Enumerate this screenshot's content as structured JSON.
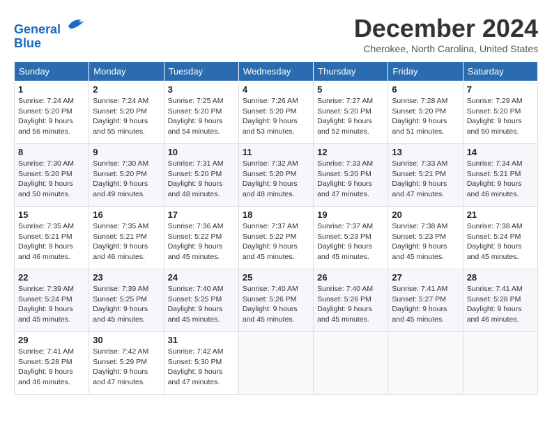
{
  "logo": {
    "line1": "General",
    "line2": "Blue"
  },
  "title": "December 2024",
  "location": "Cherokee, North Carolina, United States",
  "days_header": [
    "Sunday",
    "Monday",
    "Tuesday",
    "Wednesday",
    "Thursday",
    "Friday",
    "Saturday"
  ],
  "weeks": [
    [
      {
        "day": "1",
        "sunrise": "7:24 AM",
        "sunset": "5:20 PM",
        "daylight": "9 hours and 56 minutes."
      },
      {
        "day": "2",
        "sunrise": "7:24 AM",
        "sunset": "5:20 PM",
        "daylight": "9 hours and 55 minutes."
      },
      {
        "day": "3",
        "sunrise": "7:25 AM",
        "sunset": "5:20 PM",
        "daylight": "9 hours and 54 minutes."
      },
      {
        "day": "4",
        "sunrise": "7:26 AM",
        "sunset": "5:20 PM",
        "daylight": "9 hours and 53 minutes."
      },
      {
        "day": "5",
        "sunrise": "7:27 AM",
        "sunset": "5:20 PM",
        "daylight": "9 hours and 52 minutes."
      },
      {
        "day": "6",
        "sunrise": "7:28 AM",
        "sunset": "5:20 PM",
        "daylight": "9 hours and 51 minutes."
      },
      {
        "day": "7",
        "sunrise": "7:29 AM",
        "sunset": "5:20 PM",
        "daylight": "9 hours and 50 minutes."
      }
    ],
    [
      {
        "day": "8",
        "sunrise": "7:30 AM",
        "sunset": "5:20 PM",
        "daylight": "9 hours and 50 minutes."
      },
      {
        "day": "9",
        "sunrise": "7:30 AM",
        "sunset": "5:20 PM",
        "daylight": "9 hours and 49 minutes."
      },
      {
        "day": "10",
        "sunrise": "7:31 AM",
        "sunset": "5:20 PM",
        "daylight": "9 hours and 48 minutes."
      },
      {
        "day": "11",
        "sunrise": "7:32 AM",
        "sunset": "5:20 PM",
        "daylight": "9 hours and 48 minutes."
      },
      {
        "day": "12",
        "sunrise": "7:33 AM",
        "sunset": "5:20 PM",
        "daylight": "9 hours and 47 minutes."
      },
      {
        "day": "13",
        "sunrise": "7:33 AM",
        "sunset": "5:21 PM",
        "daylight": "9 hours and 47 minutes."
      },
      {
        "day": "14",
        "sunrise": "7:34 AM",
        "sunset": "5:21 PM",
        "daylight": "9 hours and 46 minutes."
      }
    ],
    [
      {
        "day": "15",
        "sunrise": "7:35 AM",
        "sunset": "5:21 PM",
        "daylight": "9 hours and 46 minutes."
      },
      {
        "day": "16",
        "sunrise": "7:35 AM",
        "sunset": "5:21 PM",
        "daylight": "9 hours and 46 minutes."
      },
      {
        "day": "17",
        "sunrise": "7:36 AM",
        "sunset": "5:22 PM",
        "daylight": "9 hours and 45 minutes."
      },
      {
        "day": "18",
        "sunrise": "7:37 AM",
        "sunset": "5:22 PM",
        "daylight": "9 hours and 45 minutes."
      },
      {
        "day": "19",
        "sunrise": "7:37 AM",
        "sunset": "5:23 PM",
        "daylight": "9 hours and 45 minutes."
      },
      {
        "day": "20",
        "sunrise": "7:38 AM",
        "sunset": "5:23 PM",
        "daylight": "9 hours and 45 minutes."
      },
      {
        "day": "21",
        "sunrise": "7:38 AM",
        "sunset": "5:24 PM",
        "daylight": "9 hours and 45 minutes."
      }
    ],
    [
      {
        "day": "22",
        "sunrise": "7:39 AM",
        "sunset": "5:24 PM",
        "daylight": "9 hours and 45 minutes."
      },
      {
        "day": "23",
        "sunrise": "7:39 AM",
        "sunset": "5:25 PM",
        "daylight": "9 hours and 45 minutes."
      },
      {
        "day": "24",
        "sunrise": "7:40 AM",
        "sunset": "5:25 PM",
        "daylight": "9 hours and 45 minutes."
      },
      {
        "day": "25",
        "sunrise": "7:40 AM",
        "sunset": "5:26 PM",
        "daylight": "9 hours and 45 minutes."
      },
      {
        "day": "26",
        "sunrise": "7:40 AM",
        "sunset": "5:26 PM",
        "daylight": "9 hours and 45 minutes."
      },
      {
        "day": "27",
        "sunrise": "7:41 AM",
        "sunset": "5:27 PM",
        "daylight": "9 hours and 45 minutes."
      },
      {
        "day": "28",
        "sunrise": "7:41 AM",
        "sunset": "5:28 PM",
        "daylight": "9 hours and 46 minutes."
      }
    ],
    [
      {
        "day": "29",
        "sunrise": "7:41 AM",
        "sunset": "5:28 PM",
        "daylight": "9 hours and 46 minutes."
      },
      {
        "day": "30",
        "sunrise": "7:42 AM",
        "sunset": "5:29 PM",
        "daylight": "9 hours and 47 minutes."
      },
      {
        "day": "31",
        "sunrise": "7:42 AM",
        "sunset": "5:30 PM",
        "daylight": "9 hours and 47 minutes."
      },
      null,
      null,
      null,
      null
    ]
  ]
}
